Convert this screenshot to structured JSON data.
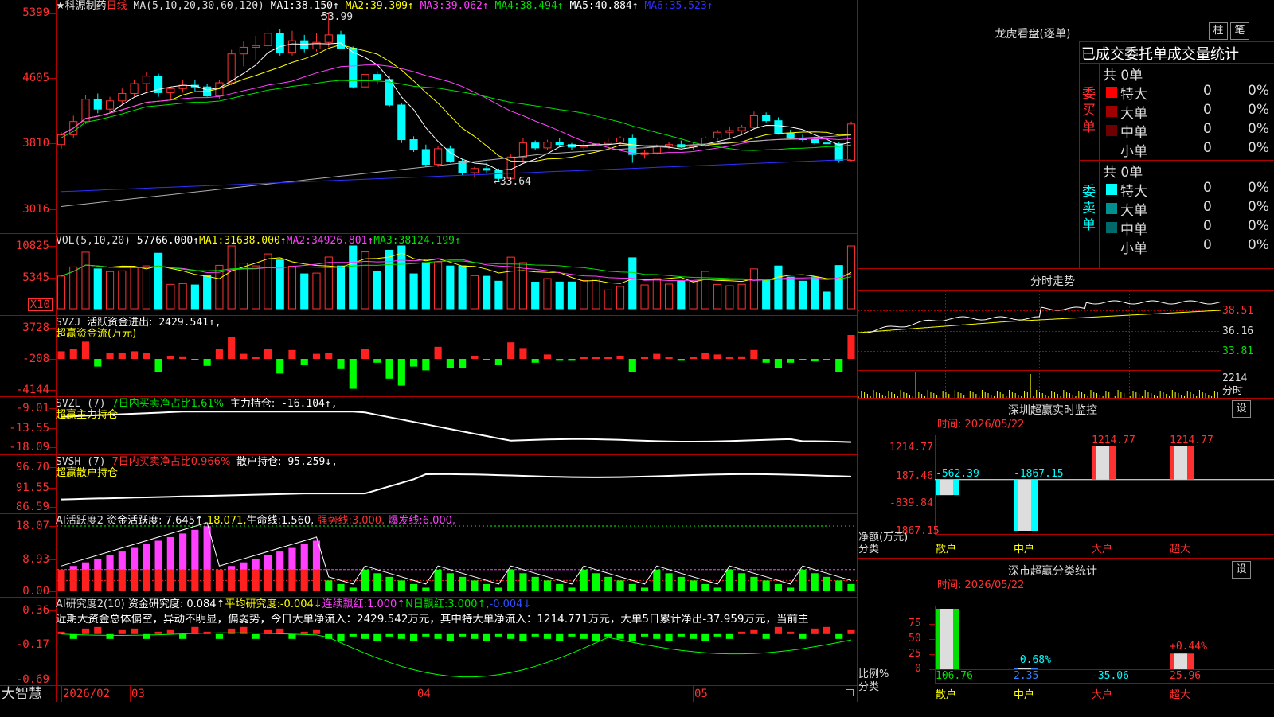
{
  "colors": {
    "up": "#ff3232",
    "down": "#00ffff",
    "ma1": "#ffffff",
    "ma2": "#ffff00",
    "ma3": "#ff40ff",
    "ma4": "#00e000",
    "ma5": "#b0b0b0",
    "ma6": "#3030ff",
    "grid": "#b00000",
    "pos": "#ff2020",
    "neg": "#00ff00",
    "magenta": "#ff40ff"
  },
  "price_panel": {
    "title": "★科源制药",
    "period": "日线",
    "ma_label": "MA(5,10,20,30,60,120)",
    "ma": [
      {
        "name": "MA1:",
        "value": "38.150↑",
        "color": "#ffffff"
      },
      {
        "name": "MA2:",
        "value": "39.309↑",
        "color": "#ffff00"
      },
      {
        "name": "MA3:",
        "value": "39.062↑",
        "color": "#ff40ff"
      },
      {
        "name": "MA4:",
        "value": "38.494↑",
        "color": "#00e000"
      },
      {
        "name": "MA5:",
        "value": "40.884↑",
        "color": "#ffffff"
      },
      {
        "name": "MA6:",
        "value": "35.523↑",
        "color": "#3030ff"
      }
    ],
    "yticks": [
      "5399",
      "4605",
      "3810",
      "3016"
    ],
    "high_note": "53.99",
    "low_note": "←33.64"
  },
  "vol_panel": {
    "label": "VOL(5,10,20)",
    "value": "57766.000↑",
    "ma": [
      {
        "name": "MA1:",
        "value": "31638.000↑",
        "color": "#ffff00"
      },
      {
        "name": "MA2:",
        "value": "34926.801↑",
        "color": "#ff40ff"
      },
      {
        "name": "MA3:",
        "value": "38124.199↑",
        "color": "#00e000"
      }
    ],
    "yticks": [
      "10825",
      "5345"
    ],
    "unit": "X10"
  },
  "svzj_panel": {
    "label": "SVZJ",
    "item": "活跃资金进出:",
    "value": "2429.541↑,",
    "sub": "超赢资金流(万元)",
    "yticks": [
      "3728",
      "-208",
      "-4144"
    ]
  },
  "svzl_panel": {
    "label": "SVZL (7)",
    "note": "7日内买卖净占比1.61%",
    "item": "主力持仓:",
    "value": "-16.104↑,",
    "sub": "超赢主力持仓",
    "yticks": [
      "-9.01",
      "-13.55",
      "-18.09"
    ]
  },
  "svsh_panel": {
    "label": "SVSH (7)",
    "note": "7日内买卖净占比0.966%",
    "item": "散户持仓:",
    "value": "95.259↓,",
    "sub": "超赢散户持仓",
    "yticks": [
      "96.70",
      "91.55",
      "86.59"
    ]
  },
  "ai_act_panel": {
    "label": "AI活跃度2",
    "item": "资金活跃度:",
    "value": "7.645↑,",
    "value2": "18.071,",
    "life": "生命线:",
    "life_value": "1.560,",
    "strong": "强势线:",
    "strong_value": "3.000,",
    "burst": "爆发线:",
    "burst_value": "6.000,",
    "yticks": [
      "18.07",
      "8.93",
      "0.00"
    ]
  },
  "ai_res_panel": {
    "label": "AI研究度2(10)",
    "item": "资金研究度:",
    "value": "0.084↑",
    "avg": "平均研究度:",
    "avg_value": "-0.004↓",
    "red": "连续飘红:",
    "red_value": "1.000↑",
    "nred": "N日飘红:",
    "nred_value": "3.000↑,",
    "tail": "-0.004↓",
    "comment": "近期大资金总体偏空，异动不明显，偏弱势，今日大单净流入：2429.542万元，其中特大单净流入：1214.771万元，大单5日累计净出-37.959万元，当前主",
    "yticks": [
      "0.36",
      "-0.17",
      "-0.69"
    ]
  },
  "xaxis": {
    "logo": "大智慧",
    "labels": [
      "2026/02",
      "03",
      "04",
      "05"
    ]
  },
  "lhb": {
    "title": "龙虎看盘(逐单)",
    "btn1": "柱",
    "btn2": "笔",
    "header": "已成交委托单成交量统计",
    "buy_label": "委买单",
    "sell_label": "委卖单",
    "buy_total": "共 0单",
    "sell_total": "共 0单",
    "buy_rows": [
      {
        "name": "特大",
        "count": "0",
        "pct": "0%",
        "color": "#ff0000"
      },
      {
        "name": "大单",
        "count": "0",
        "pct": "0%",
        "color": "#a00000"
      },
      {
        "name": "中单",
        "count": "0",
        "pct": "0%",
        "color": "#700000"
      },
      {
        "name": "小单",
        "count": "0",
        "pct": "0%",
        "color": ""
      }
    ],
    "sell_rows": [
      {
        "name": "特大",
        "count": "0",
        "pct": "0%",
        "color": "#00ffff"
      },
      {
        "name": "大单",
        "count": "0",
        "pct": "0%",
        "color": "#009090"
      },
      {
        "name": "中单",
        "count": "0",
        "pct": "0%",
        "color": "#006a6a"
      },
      {
        "name": "小单",
        "count": "0",
        "pct": "0%",
        "color": ""
      }
    ]
  },
  "fenshi": {
    "title": "分时走势",
    "yticks": [
      "38.51",
      "36.16",
      "33.81"
    ],
    "vol_label": "2214",
    "vol_unit": "分时"
  },
  "sz_monitor": {
    "title": "深圳超赢实时监控",
    "btn": "设",
    "time": "时间: 2026/05/22",
    "yticks": [
      "1214.77",
      "187.46",
      "-839.84",
      "-1867.15"
    ],
    "ylabel": "净额(万元)",
    "xlabel": "分类",
    "bars": [
      {
        "cat": "散户",
        "value": -562.39,
        "label": "-562.39"
      },
      {
        "cat": "中户",
        "value": -1867.15,
        "label": "-1867.15"
      },
      {
        "cat": "大户",
        "value": 1214.77,
        "label": "1214.77"
      },
      {
        "cat": "超大",
        "value": 1214.77,
        "label": "1214.77"
      }
    ]
  },
  "sz_class": {
    "title": "深市超赢分类统计",
    "btn": "设",
    "time": "时间: 2026/05/22",
    "yticks": [
      "75",
      "50",
      "25",
      "0"
    ],
    "ylabel": "比例%",
    "xlabel": "分类",
    "bars": [
      {
        "cat": "散户",
        "value": 106.76,
        "label": "106.76",
        "top": ""
      },
      {
        "cat": "中户",
        "value": 2.35,
        "label": "2.35",
        "top": "-0.68%"
      },
      {
        "cat": "大户",
        "value": -35.06,
        "label": "-35.06",
        "top": ""
      },
      {
        "cat": "超大",
        "value": 25.96,
        "label": "25.96",
        "top": "+0.44%"
      }
    ]
  },
  "chart_data": {
    "type": "candlestick",
    "candles_approx": [
      [
        38.0,
        39.5,
        37.5,
        39.2
      ],
      [
        39.2,
        41.5,
        38.8,
        40.8
      ],
      [
        40.8,
        44.0,
        40.5,
        43.5
      ],
      [
        43.5,
        44.2,
        41.8,
        42.3
      ],
      [
        42.3,
        43.8,
        41.8,
        43.3
      ],
      [
        43.3,
        44.8,
        42.8,
        44.2
      ],
      [
        44.2,
        45.8,
        43.8,
        45.4
      ],
      [
        45.4,
        46.8,
        44.5,
        46.3
      ],
      [
        46.3,
        46.6,
        43.8,
        44.3
      ],
      [
        44.3,
        45.0,
        43.5,
        44.8
      ],
      [
        44.8,
        45.8,
        44.3,
        45.2
      ],
      [
        45.2,
        45.8,
        44.5,
        45.0
      ],
      [
        45.0,
        45.4,
        43.8,
        43.9
      ],
      [
        43.9,
        45.8,
        43.5,
        45.5
      ],
      [
        45.5,
        49.5,
        45.2,
        49.0
      ],
      [
        49.0,
        50.5,
        47.5,
        49.8
      ],
      [
        49.8,
        51.2,
        48.2,
        50.0
      ],
      [
        50.0,
        52.2,
        49.0,
        51.5
      ],
      [
        51.5,
        52.0,
        48.8,
        49.2
      ],
      [
        49.2,
        51.8,
        48.8,
        50.6
      ],
      [
        50.6,
        51.3,
        49.2,
        49.6
      ],
      [
        49.6,
        51.5,
        49.3,
        50.4
      ],
      [
        50.4,
        53.99,
        49.8,
        51.3
      ],
      [
        51.3,
        51.8,
        49.8,
        49.7
      ],
      [
        49.7,
        49.9,
        44.8,
        45.0
      ],
      [
        45.0,
        47.2,
        43.5,
        46.5
      ],
      [
        46.5,
        46.9,
        45.3,
        45.9
      ],
      [
        45.9,
        46.3,
        42.5,
        42.8
      ],
      [
        42.8,
        43.0,
        38.2,
        38.6
      ],
      [
        38.6,
        39.0,
        37.1,
        37.4
      ],
      [
        37.4,
        38.0,
        35.3,
        35.6
      ],
      [
        35.6,
        37.8,
        35.3,
        37.5
      ],
      [
        37.5,
        37.9,
        35.8,
        36.0
      ],
      [
        36.0,
        36.3,
        34.3,
        34.6
      ],
      [
        34.6,
        35.3,
        34.0,
        35.1
      ],
      [
        35.1,
        35.8,
        34.5,
        34.9
      ],
      [
        34.9,
        35.1,
        33.64,
        33.9
      ],
      [
        33.9,
        36.8,
        33.7,
        36.5
      ],
      [
        36.5,
        38.8,
        35.8,
        38.2
      ],
      [
        38.2,
        38.5,
        37.4,
        37.6
      ],
      [
        37.6,
        38.6,
        37.3,
        38.3
      ],
      [
        38.3,
        38.8,
        37.8,
        38.0
      ],
      [
        38.0,
        38.2,
        37.4,
        37.7
      ],
      [
        37.7,
        38.2,
        37.3,
        37.9
      ],
      [
        37.9,
        38.4,
        37.5,
        38.1
      ],
      [
        38.1,
        38.7,
        37.7,
        38.3
      ],
      [
        38.3,
        39.0,
        38.0,
        38.8
      ],
      [
        38.8,
        39.2,
        35.8,
        36.8
      ],
      [
        36.8,
        37.4,
        36.3,
        37.0
      ],
      [
        37.0,
        38.0,
        36.8,
        37.8
      ],
      [
        37.8,
        38.3,
        37.5,
        38.0
      ],
      [
        38.0,
        38.5,
        37.6,
        37.7
      ],
      [
        37.7,
        38.2,
        37.4,
        37.9
      ],
      [
        37.9,
        39.0,
        37.7,
        38.8
      ],
      [
        38.8,
        39.8,
        38.5,
        39.5
      ],
      [
        39.5,
        40.2,
        38.8,
        39.7
      ],
      [
        39.7,
        40.4,
        39.2,
        40.1
      ],
      [
        40.1,
        42.0,
        39.8,
        41.5
      ],
      [
        41.5,
        41.9,
        40.7,
        40.9
      ],
      [
        40.9,
        41.3,
        39.2,
        39.4
      ],
      [
        39.4,
        39.8,
        38.6,
        38.8
      ],
      [
        38.8,
        39.2,
        38.4,
        38.6
      ],
      [
        38.6,
        39.0,
        38.0,
        38.2
      ],
      [
        38.2,
        38.8,
        38.0,
        38.1
      ],
      [
        38.1,
        38.3,
        35.8,
        36.1
      ],
      [
        36.1,
        40.8,
        35.9,
        40.5
      ]
    ]
  }
}
